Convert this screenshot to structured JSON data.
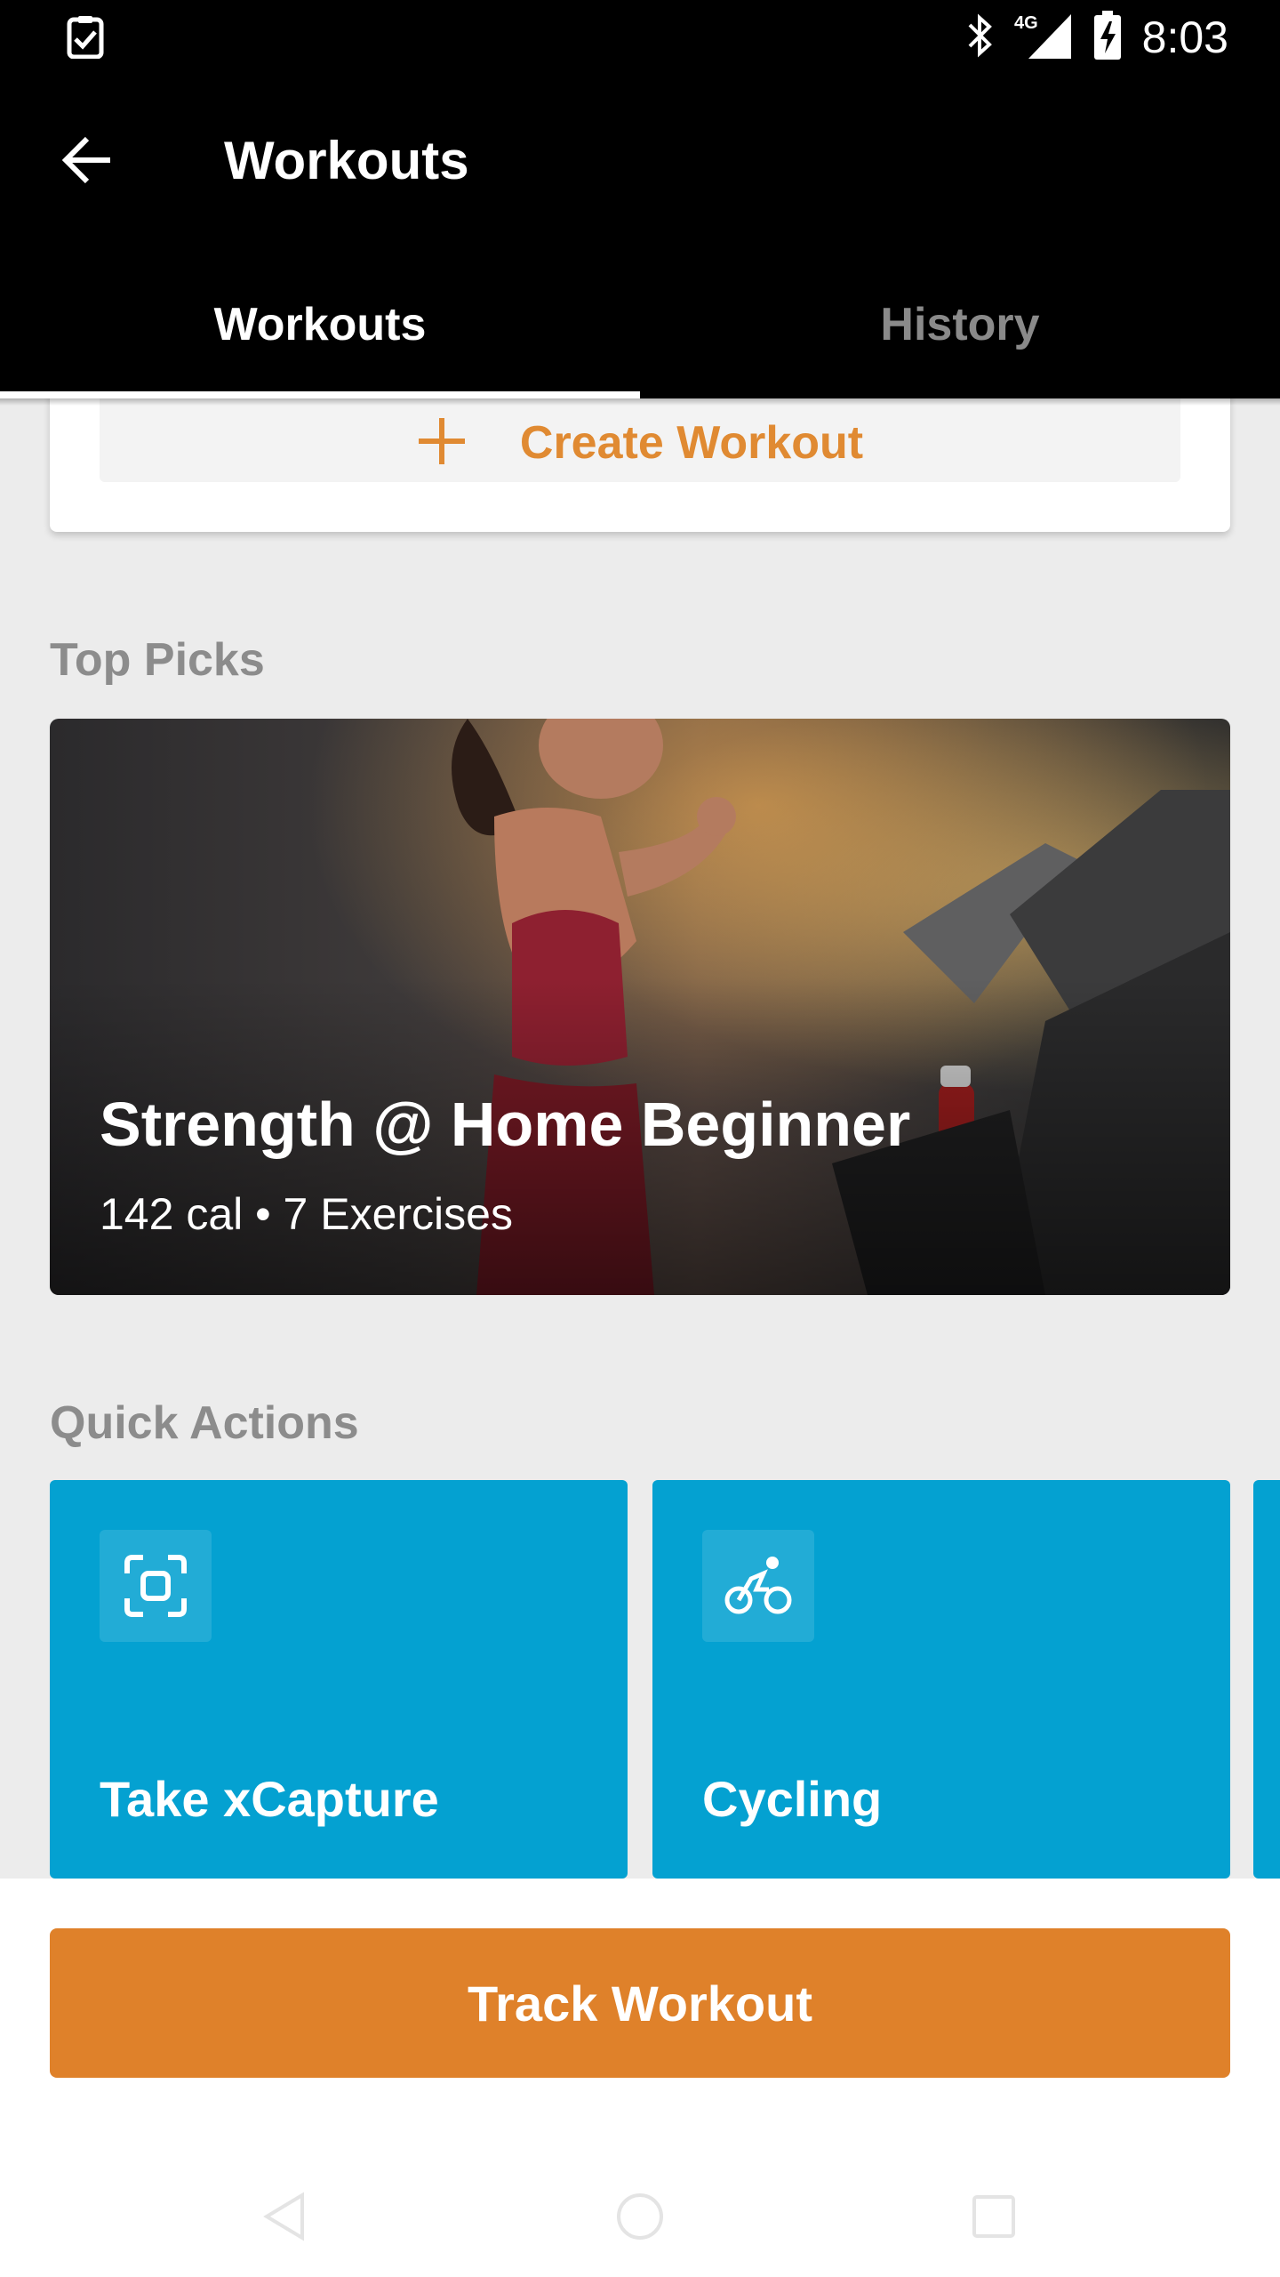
{
  "status_bar": {
    "time": "8:03",
    "network": "4G",
    "icons": [
      "checklist-icon",
      "bluetooth-icon",
      "signal-icon",
      "battery-charging-icon"
    ]
  },
  "app_bar": {
    "title": "Workouts",
    "back_icon": "arrow-back-icon"
  },
  "tabs": [
    {
      "label": "Workouts",
      "active": true
    },
    {
      "label": "History",
      "active": false
    }
  ],
  "create_workout": {
    "label": "Create Workout",
    "icon": "plus-icon"
  },
  "top_picks": {
    "section_title": "Top Picks",
    "card": {
      "title": "Strength @ Home Beginner",
      "meta": "142 cal • 7 Exercises"
    }
  },
  "quick_actions": {
    "section_title": "Quick Actions",
    "items": [
      {
        "label": "Take xCapture",
        "icon": "scan-frame-icon"
      },
      {
        "label": "Cycling",
        "icon": "cyclist-icon"
      }
    ]
  },
  "track_workout": {
    "label": "Track Workout"
  },
  "colors": {
    "accent_orange": "#df812a",
    "quick_action_blue": "#04a1d1",
    "header_black": "#000000",
    "background": "#ececec"
  },
  "system_nav": [
    "nav-back-icon",
    "nav-home-icon",
    "nav-recents-icon"
  ]
}
